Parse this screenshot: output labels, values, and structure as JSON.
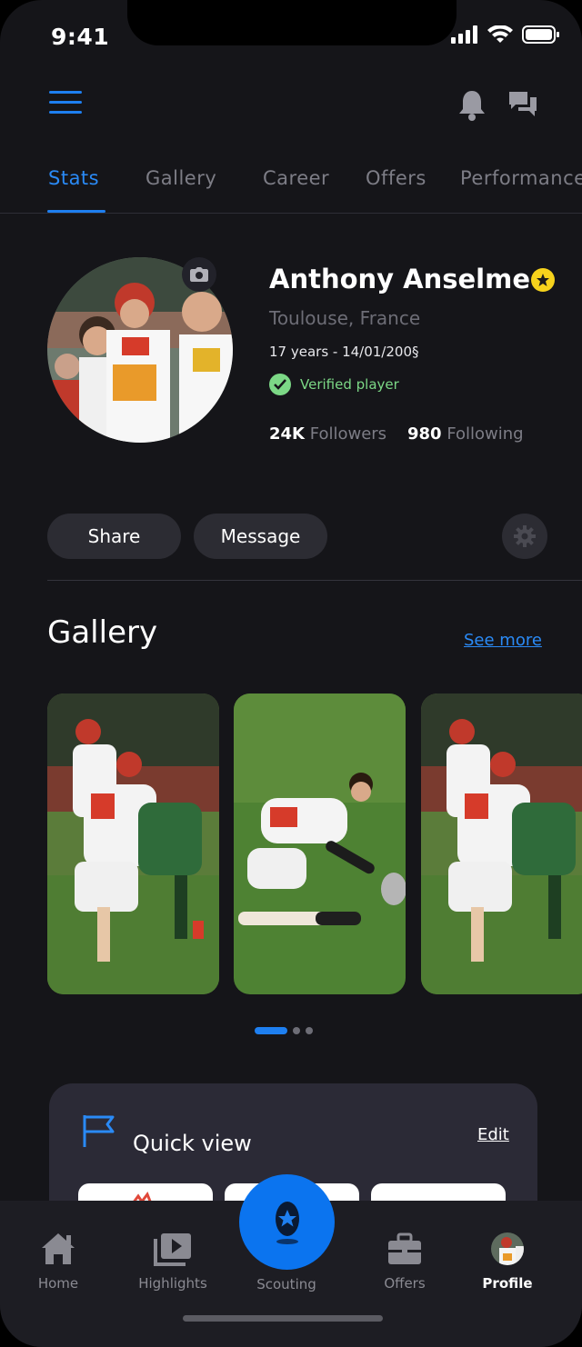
{
  "status_bar": {
    "time": "9:41"
  },
  "tabs": [
    {
      "label": "Stats",
      "active": true
    },
    {
      "label": "Gallery"
    },
    {
      "label": "Career"
    },
    {
      "label": "Offers"
    },
    {
      "label": "Performance"
    }
  ],
  "profile": {
    "name": "Anthony Anselme",
    "location": "Toulouse, France",
    "age_dob": "17 years - 14/01/200§",
    "verified_label": "Verified player",
    "followers_count": "24K",
    "followers_label": "Followers",
    "following_count": "980",
    "following_label": "Following"
  },
  "actions": {
    "share_label": "Share",
    "message_label": "Message"
  },
  "gallery": {
    "title": "Gallery",
    "see_more": "See more",
    "active_page": 1,
    "pages": 3
  },
  "quick_view": {
    "title": "Quick view",
    "edit_label": "Edit"
  },
  "bottom_nav": {
    "home": "Home",
    "highlights": "Highlights",
    "scouting": "Scouting",
    "offers": "Offers",
    "profile": "Profile",
    "active": "Profile"
  },
  "colors": {
    "accent": "#1e7ff0",
    "verified": "#7cd886",
    "star": "#f6d21c",
    "background": "#151519"
  },
  "icons": [
    "menu-icon",
    "bell-icon",
    "chat-icon",
    "camera-icon",
    "star-icon",
    "check-icon",
    "gear-icon",
    "flag-icon",
    "home-icon",
    "highlights-icon",
    "rugby-ball-icon",
    "briefcase-icon"
  ]
}
